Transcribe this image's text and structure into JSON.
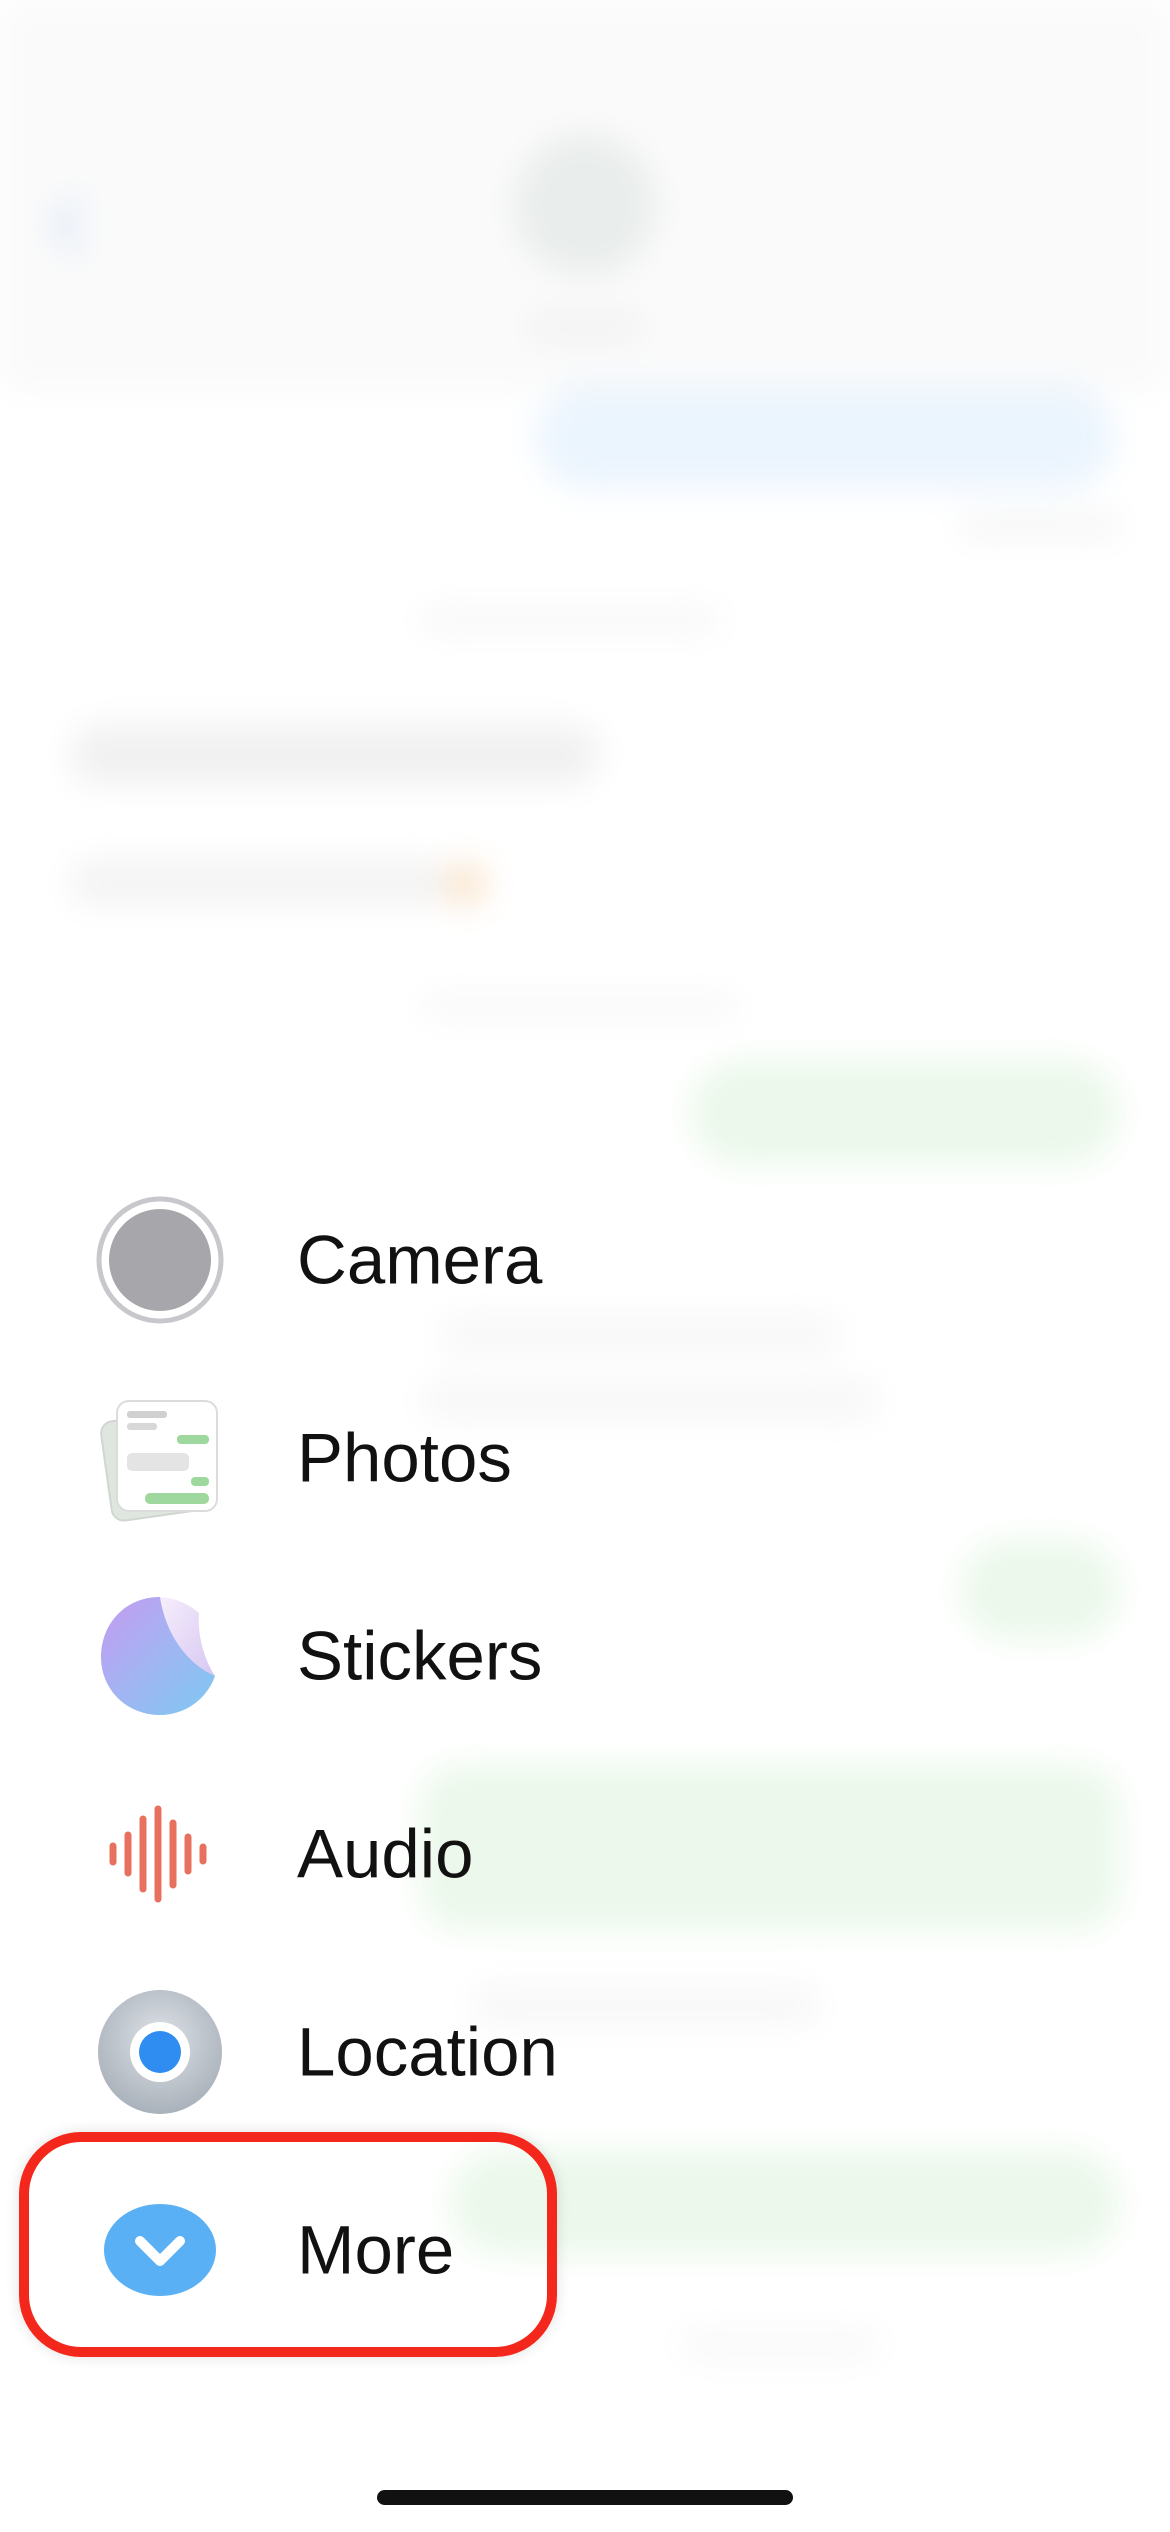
{
  "menu": {
    "items": [
      {
        "id": "camera",
        "label": "Camera",
        "icon": "camera-icon"
      },
      {
        "id": "photos",
        "label": "Photos",
        "icon": "photos-icon"
      },
      {
        "id": "stickers",
        "label": "Stickers",
        "icon": "stickers-icon"
      },
      {
        "id": "audio",
        "label": "Audio",
        "icon": "audio-waveform-icon"
      },
      {
        "id": "location",
        "label": "Location",
        "icon": "location-icon"
      },
      {
        "id": "more",
        "label": "More",
        "icon": "chevron-down-icon"
      }
    ],
    "highlighted_item": "more"
  },
  "colors": {
    "highlight_outline": "#f4271c",
    "audio_icon": "#e8705f",
    "more_icon": "#5ab0f5",
    "location_dot": "#2f8cf0",
    "sent_bubble_green": "#cfeecf",
    "blue_bubble": "#cfe6fb"
  }
}
